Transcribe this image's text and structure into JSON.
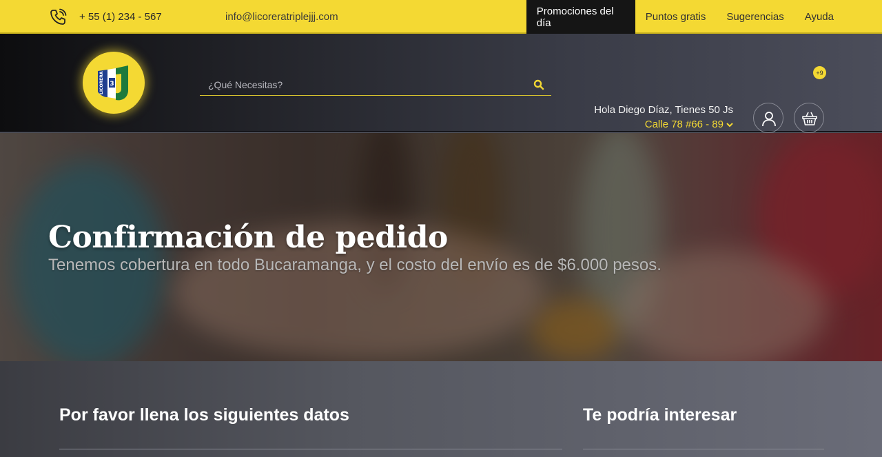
{
  "topbar": {
    "phone": "+ 55 (1) 234 - 567",
    "email": "info@licoreratriplejjj.com",
    "nav": [
      {
        "label": "Promociones del día",
        "active": true
      },
      {
        "label": "Puntos gratis",
        "active": false
      },
      {
        "label": "Sugerencias",
        "active": false
      },
      {
        "label": "Ayuda",
        "active": false
      }
    ],
    "colors": {
      "bar": "#f4d933",
      "active_bg": "#151515"
    }
  },
  "header": {
    "logo": {
      "text": "LICORERA",
      "number": "3",
      "letter": "J"
    },
    "search": {
      "placeholder": "¿Qué Necesitas?"
    },
    "greeting": "Hola Diego Díaz, Tienes 50 Js",
    "address": "Calle 78 #66 - 89",
    "cart_badge": "+9",
    "icons": [
      "search-icon",
      "chevron-down-icon",
      "user-icon",
      "basket-icon"
    ]
  },
  "hero": {
    "title": "Confirmación de pedido",
    "subtitle": "Tenemos cobertura en todo Bucaramanga, y el costo del envío es de $6.000 pesos."
  },
  "content": {
    "left_title": "Por favor llena los siguientes datos",
    "right_title": "Te podría interesar"
  }
}
